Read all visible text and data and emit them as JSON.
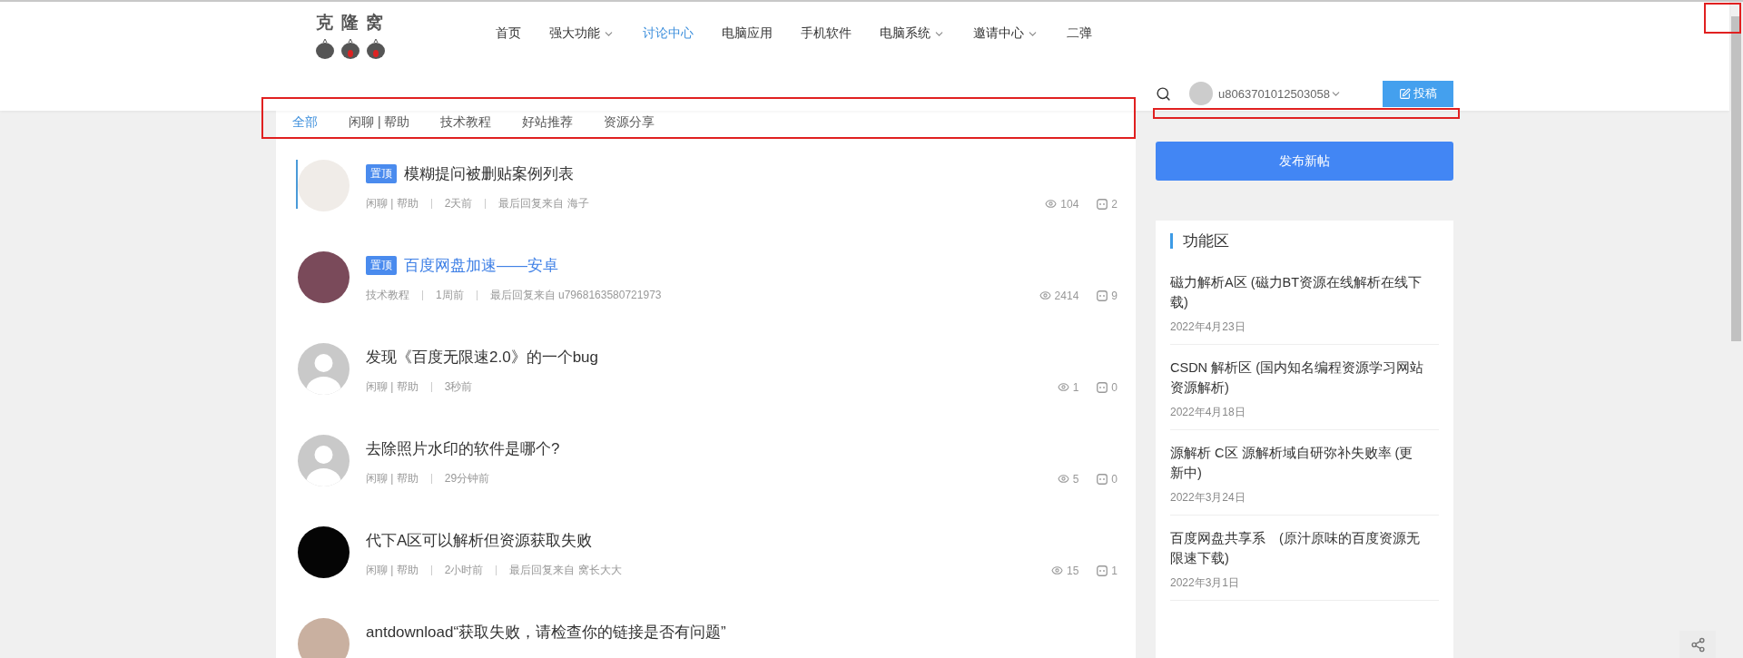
{
  "logo": {
    "text": "克 隆 窝"
  },
  "nav": [
    {
      "label": "首页",
      "selected": false,
      "dropdown": false
    },
    {
      "label": "强大功能",
      "selected": false,
      "dropdown": true
    },
    {
      "label": "讨论中心",
      "selected": true,
      "dropdown": false
    },
    {
      "label": "电脑应用",
      "selected": false,
      "dropdown": false
    },
    {
      "label": "手机软件",
      "selected": false,
      "dropdown": false
    },
    {
      "label": "电脑系统",
      "selected": false,
      "dropdown": true
    },
    {
      "label": "邀请中心",
      "selected": false,
      "dropdown": true
    },
    {
      "label": "二弹",
      "selected": false,
      "dropdown": false
    }
  ],
  "user": {
    "name": "u8063701012503058"
  },
  "submit_button": "投稿",
  "tabs": [
    {
      "label": "全部",
      "selected": true
    },
    {
      "label": "闲聊 | 帮助",
      "selected": false
    },
    {
      "label": "技术教程",
      "selected": false
    },
    {
      "label": "好站推荐",
      "selected": false
    },
    {
      "label": "资源分享",
      "selected": false
    }
  ],
  "posts": [
    {
      "kind": "photo",
      "color": "#f0ece8",
      "pin_label": "置顶",
      "title": "模糊提问被删贴案例列表",
      "highlighted": false,
      "marked": true,
      "category": "闲聊 | 帮助",
      "time": "2天前",
      "last_reply": "最后回复来自 海子",
      "views": "104",
      "comments": "2"
    },
    {
      "kind": "photo",
      "color": "#7a4a5a",
      "pin_label": "置顶",
      "title": "百度网盘加速——安卓",
      "highlighted": true,
      "marked": false,
      "category": "技术教程",
      "time": "1周前",
      "last_reply": "最后回复来自 u7968163580721973",
      "views": "2414",
      "comments": "9"
    },
    {
      "kind": "default",
      "title": "发现《百度无限速2.0》的一个bug",
      "highlighted": false,
      "marked": false,
      "category": "闲聊 | 帮助",
      "time": "3秒前",
      "views": "1",
      "comments": "0"
    },
    {
      "kind": "default",
      "title": "去除照片水印的软件是哪个?",
      "highlighted": false,
      "marked": false,
      "category": "闲聊 | 帮助",
      "time": "29分钟前",
      "views": "5",
      "comments": "0"
    },
    {
      "kind": "photo",
      "color": "#050505",
      "title": "代下A区可以解析但资源获取失败",
      "highlighted": false,
      "marked": false,
      "category": "闲聊 | 帮助",
      "time": "2小时前",
      "last_reply": "最后回复来自 窝长大大",
      "views": "15",
      "comments": "1"
    },
    {
      "kind": "photo",
      "color": "#c9b0a0",
      "title": "antdownload“获取失败，请检查你的链接是否有问题”",
      "highlighted": false,
      "marked": false
    }
  ],
  "new_post_button": "发布新帖",
  "sidebar": {
    "title": "功能区",
    "items": [
      {
        "title": "磁力解析A区 (磁力BT资源在线解析在线下载)",
        "date": "2022年4月23日"
      },
      {
        "title": "CSDN 解析区 (国内知名编程资源学习网站资源解析)",
        "date": "2022年4月18日"
      },
      {
        "title": "源解析 C区 源解析域自研弥补失败率 (更新中)",
        "date": "2022年3月24日"
      },
      {
        "title": "百度网盘共享系　(原汁原味的百度资源无限速下载)",
        "date": "2022年3月1日"
      }
    ]
  }
}
